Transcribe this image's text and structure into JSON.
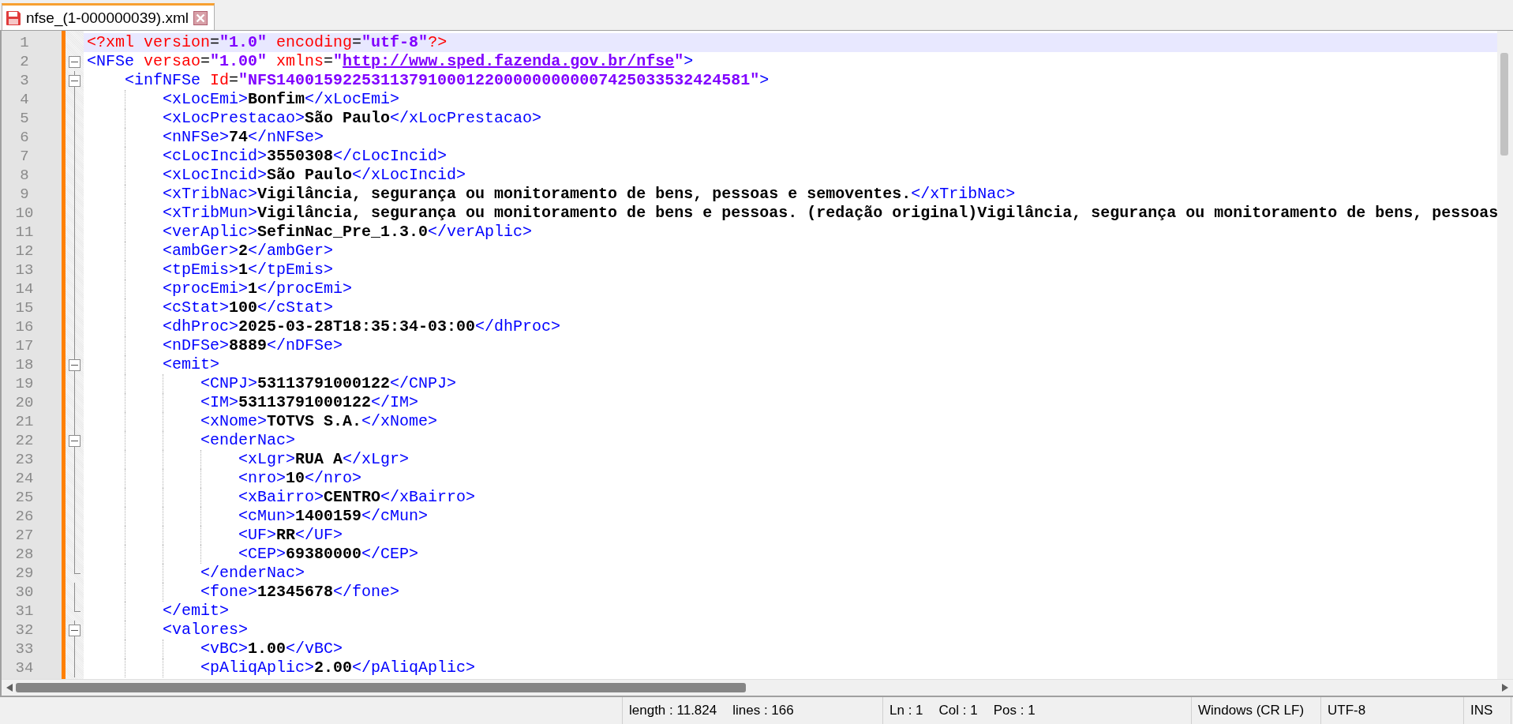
{
  "tabs": [
    {
      "label": "nfse_(1-000000039).xml",
      "selected": true,
      "unsaved": true
    }
  ],
  "lines": [
    {
      "number": "1",
      "kind": "plain",
      "current": true,
      "tokens": [
        {
          "kind": "pi",
          "text": "<?xml"
        },
        {
          "kind": "attr",
          "text": " version"
        },
        {
          "kind": "eq",
          "text": "="
        },
        {
          "kind": "value",
          "text": "\"1.0\""
        },
        {
          "kind": "attr",
          "text": " encoding"
        },
        {
          "kind": "eq",
          "text": "="
        },
        {
          "kind": "value",
          "text": "\"utf-8\""
        },
        {
          "kind": "pi",
          "text": "?>"
        }
      ]
    },
    {
      "number": "2",
      "kind": "open",
      "current": false,
      "tokens": [
        {
          "kind": "tag",
          "text": "<NFSe"
        },
        {
          "kind": "attr",
          "text": " versao"
        },
        {
          "kind": "eq",
          "text": "="
        },
        {
          "kind": "value",
          "text": "\"1.00\""
        },
        {
          "kind": "attr",
          "text": " xmlns"
        },
        {
          "kind": "eq",
          "text": "="
        },
        {
          "kind": "value",
          "text": "\""
        },
        {
          "kind": "link",
          "text": "http://www.sped.fazenda.gov.br/nfse"
        },
        {
          "kind": "value",
          "text": "\""
        },
        {
          "kind": "tag",
          "text": ">"
        }
      ]
    },
    {
      "number": "3",
      "kind": "open",
      "current": false,
      "tokens": [
        {
          "kind": "tag",
          "text": "    <infNFSe"
        },
        {
          "kind": "attr",
          "text": " Id"
        },
        {
          "kind": "eq",
          "text": "="
        },
        {
          "kind": "value",
          "text": "\"NFS14001592253113791000122000000000007425033532424581\""
        },
        {
          "kind": "tag",
          "text": ">"
        }
      ]
    },
    {
      "number": "4",
      "kind": "line",
      "current": false,
      "tokens": [
        {
          "kind": "tag",
          "text": "        <xLocEmi>"
        },
        {
          "kind": "text",
          "text": "Bonfim"
        },
        {
          "kind": "tag",
          "text": "</xLocEmi>"
        }
      ]
    },
    {
      "number": "5",
      "kind": "line",
      "current": false,
      "tokens": [
        {
          "kind": "tag",
          "text": "        <xLocPrestacao>"
        },
        {
          "kind": "text",
          "text": "São Paulo"
        },
        {
          "kind": "tag",
          "text": "</xLocPrestacao>"
        }
      ]
    },
    {
      "number": "6",
      "kind": "line",
      "current": false,
      "tokens": [
        {
          "kind": "tag",
          "text": "        <nNFSe>"
        },
        {
          "kind": "text",
          "text": "74"
        },
        {
          "kind": "tag",
          "text": "</nNFSe>"
        }
      ]
    },
    {
      "number": "7",
      "kind": "line",
      "current": false,
      "tokens": [
        {
          "kind": "tag",
          "text": "        <cLocIncid>"
        },
        {
          "kind": "text",
          "text": "3550308"
        },
        {
          "kind": "tag",
          "text": "</cLocIncid>"
        }
      ]
    },
    {
      "number": "8",
      "kind": "line",
      "current": false,
      "tokens": [
        {
          "kind": "tag",
          "text": "        <xLocIncid>"
        },
        {
          "kind": "text",
          "text": "São Paulo"
        },
        {
          "kind": "tag",
          "text": "</xLocIncid>"
        }
      ]
    },
    {
      "number": "9",
      "kind": "line",
      "current": false,
      "tokens": [
        {
          "kind": "tag",
          "text": "        <xTribNac>"
        },
        {
          "kind": "text",
          "text": "Vigilância, segurança ou monitoramento de bens, pessoas e semoventes."
        },
        {
          "kind": "tag",
          "text": "</xTribNac>"
        }
      ]
    },
    {
      "number": "10",
      "kind": "line",
      "current": false,
      "tokens": [
        {
          "kind": "tag",
          "text": "        <xTribMun>"
        },
        {
          "kind": "text",
          "text": "Vigilância, segurança ou monitoramento de bens e pessoas. (redação original)Vigilância, segurança ou monitoramento de bens, pessoas"
        }
      ]
    },
    {
      "number": "11",
      "kind": "line",
      "current": false,
      "tokens": [
        {
          "kind": "tag",
          "text": "        <verAplic>"
        },
        {
          "kind": "text",
          "text": "SefinNac_Pre_1.3.0"
        },
        {
          "kind": "tag",
          "text": "</verAplic>"
        }
      ]
    },
    {
      "number": "12",
      "kind": "line",
      "current": false,
      "tokens": [
        {
          "kind": "tag",
          "text": "        <ambGer>"
        },
        {
          "kind": "text",
          "text": "2"
        },
        {
          "kind": "tag",
          "text": "</ambGer>"
        }
      ]
    },
    {
      "number": "13",
      "kind": "line",
      "current": false,
      "tokens": [
        {
          "kind": "tag",
          "text": "        <tpEmis>"
        },
        {
          "kind": "text",
          "text": "1"
        },
        {
          "kind": "tag",
          "text": "</tpEmis>"
        }
      ]
    },
    {
      "number": "14",
      "kind": "line",
      "current": false,
      "tokens": [
        {
          "kind": "tag",
          "text": "        <procEmi>"
        },
        {
          "kind": "text",
          "text": "1"
        },
        {
          "kind": "tag",
          "text": "</procEmi>"
        }
      ]
    },
    {
      "number": "15",
      "kind": "line",
      "current": false,
      "tokens": [
        {
          "kind": "tag",
          "text": "        <cStat>"
        },
        {
          "kind": "text",
          "text": "100"
        },
        {
          "kind": "tag",
          "text": "</cStat>"
        }
      ]
    },
    {
      "number": "16",
      "kind": "line",
      "current": false,
      "tokens": [
        {
          "kind": "tag",
          "text": "        <dhProc>"
        },
        {
          "kind": "text",
          "text": "2025-03-28T18:35:34-03:00"
        },
        {
          "kind": "tag",
          "text": "</dhProc>"
        }
      ]
    },
    {
      "number": "17",
      "kind": "line",
      "current": false,
      "tokens": [
        {
          "kind": "tag",
          "text": "        <nDFSe>"
        },
        {
          "kind": "text",
          "text": "8889"
        },
        {
          "kind": "tag",
          "text": "</nDFSe>"
        }
      ]
    },
    {
      "number": "18",
      "kind": "open",
      "current": false,
      "tokens": [
        {
          "kind": "tag",
          "text": "        <emit>"
        }
      ]
    },
    {
      "number": "19",
      "kind": "line",
      "current": false,
      "tokens": [
        {
          "kind": "tag",
          "text": "            <CNPJ>"
        },
        {
          "kind": "text",
          "text": "53113791000122"
        },
        {
          "kind": "tag",
          "text": "</CNPJ>"
        }
      ]
    },
    {
      "number": "20",
      "kind": "line",
      "current": false,
      "tokens": [
        {
          "kind": "tag",
          "text": "            <IM>"
        },
        {
          "kind": "text",
          "text": "53113791000122"
        },
        {
          "kind": "tag",
          "text": "</IM>"
        }
      ]
    },
    {
      "number": "21",
      "kind": "line",
      "current": false,
      "tokens": [
        {
          "kind": "tag",
          "text": "            <xNome>"
        },
        {
          "kind": "text",
          "text": "TOTVS S.A."
        },
        {
          "kind": "tag",
          "text": "</xNome>"
        }
      ]
    },
    {
      "number": "22",
      "kind": "open",
      "current": false,
      "tokens": [
        {
          "kind": "tag",
          "text": "            <enderNac>"
        }
      ]
    },
    {
      "number": "23",
      "kind": "line",
      "current": false,
      "tokens": [
        {
          "kind": "tag",
          "text": "                <xLgr>"
        },
        {
          "kind": "text",
          "text": "RUA A"
        },
        {
          "kind": "tag",
          "text": "</xLgr>"
        }
      ]
    },
    {
      "number": "24",
      "kind": "line",
      "current": false,
      "tokens": [
        {
          "kind": "tag",
          "text": "                <nro>"
        },
        {
          "kind": "text",
          "text": "10"
        },
        {
          "kind": "tag",
          "text": "</nro>"
        }
      ]
    },
    {
      "number": "25",
      "kind": "line",
      "current": false,
      "tokens": [
        {
          "kind": "tag",
          "text": "                <xBairro>"
        },
        {
          "kind": "text",
          "text": "CENTRO"
        },
        {
          "kind": "tag",
          "text": "</xBairro>"
        }
      ]
    },
    {
      "number": "26",
      "kind": "line",
      "current": false,
      "tokens": [
        {
          "kind": "tag",
          "text": "                <cMun>"
        },
        {
          "kind": "text",
          "text": "1400159"
        },
        {
          "kind": "tag",
          "text": "</cMun>"
        }
      ]
    },
    {
      "number": "27",
      "kind": "line",
      "current": false,
      "tokens": [
        {
          "kind": "tag",
          "text": "                <UF>"
        },
        {
          "kind": "text",
          "text": "RR"
        },
        {
          "kind": "tag",
          "text": "</UF>"
        }
      ]
    },
    {
      "number": "28",
      "kind": "line",
      "current": false,
      "tokens": [
        {
          "kind": "tag",
          "text": "                <CEP>"
        },
        {
          "kind": "text",
          "text": "69380000"
        },
        {
          "kind": "tag",
          "text": "</CEP>"
        }
      ]
    },
    {
      "number": "29",
      "kind": "end",
      "current": false,
      "tokens": [
        {
          "kind": "tag",
          "text": "            </enderNac>"
        }
      ]
    },
    {
      "number": "30",
      "kind": "line",
      "current": false,
      "tokens": [
        {
          "kind": "tag",
          "text": "            <fone>"
        },
        {
          "kind": "text",
          "text": "12345678"
        },
        {
          "kind": "tag",
          "text": "</fone>"
        }
      ]
    },
    {
      "number": "31",
      "kind": "end",
      "current": false,
      "tokens": [
        {
          "kind": "tag",
          "text": "        </emit>"
        }
      ]
    },
    {
      "number": "32",
      "kind": "open",
      "current": false,
      "tokens": [
        {
          "kind": "tag",
          "text": "        <valores>"
        }
      ]
    },
    {
      "number": "33",
      "kind": "line",
      "current": false,
      "tokens": [
        {
          "kind": "tag",
          "text": "            <vBC>"
        },
        {
          "kind": "text",
          "text": "1.00"
        },
        {
          "kind": "tag",
          "text": "</vBC>"
        }
      ]
    },
    {
      "number": "34",
      "kind": "line",
      "current": false,
      "tokens": [
        {
          "kind": "tag",
          "text": "            <pAliqAplic>"
        },
        {
          "kind": "text",
          "text": "2.00"
        },
        {
          "kind": "tag",
          "text": "</pAliqAplic>"
        }
      ]
    }
  ],
  "status_bar": [
    {
      "items": [
        "length : 11.824",
        "lines : 166"
      ]
    },
    {
      "items": [
        "Ln : 1",
        "Col : 1",
        "Pos : 1"
      ]
    },
    {
      "items": [
        "Windows (CR LF)"
      ]
    },
    {
      "items": [
        "UTF-8"
      ]
    },
    {
      "items": [
        "INS"
      ]
    }
  ]
}
